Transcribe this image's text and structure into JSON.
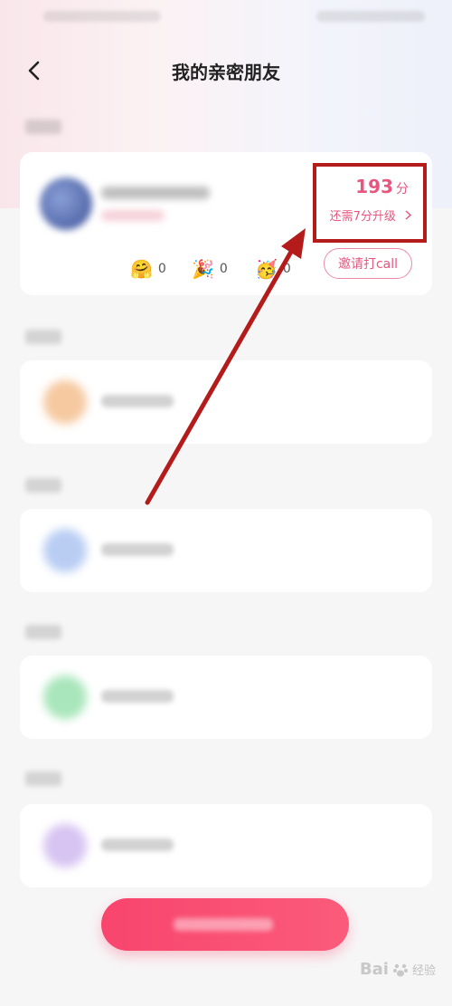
{
  "header": {
    "title": "我的亲密朋友"
  },
  "friend_card": {
    "score_value": "193",
    "score_unit": "分",
    "upgrade_text": "还需7分升级",
    "stats": [
      {
        "icon": "hug-emoji-icon",
        "emoji": "🤗",
        "count": "0"
      },
      {
        "icon": "party-popper-icon",
        "emoji": "🎉",
        "count": "0"
      },
      {
        "icon": "party-face-icon",
        "emoji": "🥳",
        "count": "0"
      }
    ],
    "invite_label": "邀请打call"
  },
  "slot_colors": [
    "#f6c9a0",
    "#b9cdf3",
    "#a9e6bb",
    "#d7c4f2"
  ],
  "accent_color": "#e8567f",
  "watermark": {
    "brand": "Bai",
    "sub": "经验"
  }
}
